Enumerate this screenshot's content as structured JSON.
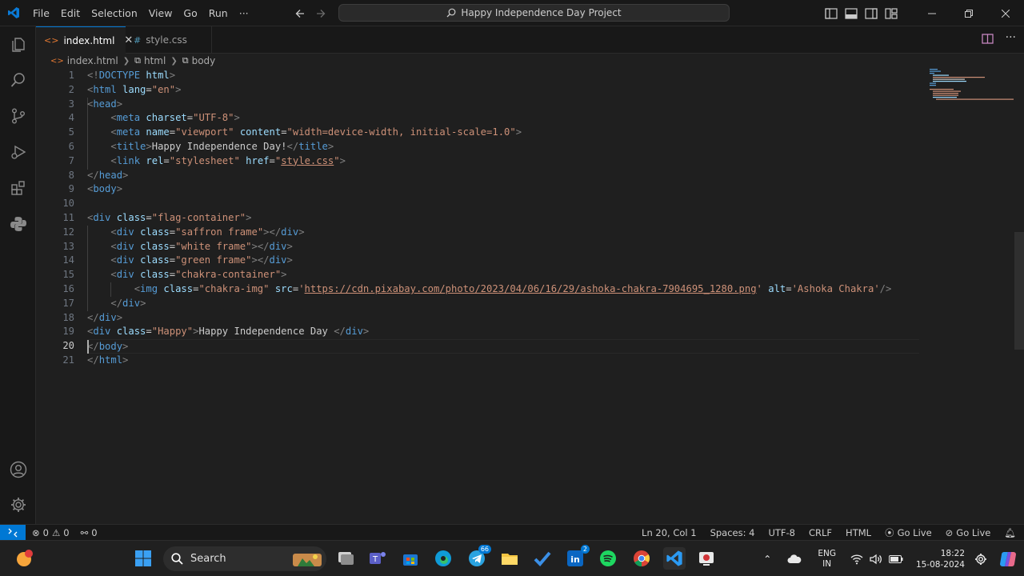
{
  "window": {
    "menu": [
      "File",
      "Edit",
      "Selection",
      "View",
      "Go",
      "Run",
      "···"
    ],
    "search_label": "Happy Independence Day Project"
  },
  "tabs": [
    {
      "label": "index.html",
      "icon": "html-file-icon",
      "active": true
    },
    {
      "label": "style.css",
      "icon": "css-file-icon",
      "active": false
    }
  ],
  "breadcrumb": [
    "index.html",
    "html",
    "body"
  ],
  "editor": {
    "line_numbers": [
      "1",
      "2",
      "3",
      "4",
      "5",
      "6",
      "7",
      "8",
      "9",
      "10",
      "11",
      "12",
      "13",
      "14",
      "15",
      "16",
      "17",
      "18",
      "19",
      "20",
      "21"
    ],
    "current_line": "20",
    "lines": [
      [
        [
          "p",
          "<!"
        ],
        [
          "t",
          "DOCTYPE"
        ],
        [
          "x",
          " "
        ],
        [
          "a",
          "html"
        ],
        [
          "p",
          ">"
        ]
      ],
      [
        [
          "p",
          "<"
        ],
        [
          "t",
          "html"
        ],
        [
          "x",
          " "
        ],
        [
          "a",
          "lang"
        ],
        [
          "x",
          "="
        ],
        [
          "s",
          "\"en\""
        ],
        [
          "p",
          ">"
        ]
      ],
      [
        [
          "p",
          "<"
        ],
        [
          "t",
          "head"
        ],
        [
          "p",
          ">"
        ]
      ],
      [
        [
          "x",
          "    "
        ],
        [
          "p",
          "<"
        ],
        [
          "t",
          "meta"
        ],
        [
          "x",
          " "
        ],
        [
          "a",
          "charset"
        ],
        [
          "x",
          "="
        ],
        [
          "s",
          "\"UTF-8\""
        ],
        [
          "p",
          ">"
        ]
      ],
      [
        [
          "x",
          "    "
        ],
        [
          "p",
          "<"
        ],
        [
          "t",
          "meta"
        ],
        [
          "x",
          " "
        ],
        [
          "a",
          "name"
        ],
        [
          "x",
          "="
        ],
        [
          "s",
          "\"viewport\""
        ],
        [
          "x",
          " "
        ],
        [
          "a",
          "content"
        ],
        [
          "x",
          "="
        ],
        [
          "s",
          "\"width=device-width, initial-scale=1.0\""
        ],
        [
          "p",
          ">"
        ]
      ],
      [
        [
          "x",
          "    "
        ],
        [
          "p",
          "<"
        ],
        [
          "t",
          "title"
        ],
        [
          "p",
          ">"
        ],
        [
          "x",
          "Happy Independence Day!"
        ],
        [
          "p",
          "</"
        ],
        [
          "t",
          "title"
        ],
        [
          "p",
          ">"
        ]
      ],
      [
        [
          "x",
          "    "
        ],
        [
          "p",
          "<"
        ],
        [
          "t",
          "link"
        ],
        [
          "x",
          " "
        ],
        [
          "a",
          "rel"
        ],
        [
          "x",
          "="
        ],
        [
          "s",
          "\"stylesheet\""
        ],
        [
          "x",
          " "
        ],
        [
          "a",
          "href"
        ],
        [
          "x",
          "="
        ],
        [
          "s",
          "\""
        ],
        [
          "u",
          "style.css"
        ],
        [
          "s",
          "\""
        ],
        [
          "p",
          ">"
        ]
      ],
      [
        [
          "p",
          "</"
        ],
        [
          "t",
          "head"
        ],
        [
          "p",
          ">"
        ]
      ],
      [
        [
          "p",
          "<"
        ],
        [
          "t",
          "body"
        ],
        [
          "p",
          ">"
        ]
      ],
      [],
      [
        [
          "p",
          "<"
        ],
        [
          "t",
          "div"
        ],
        [
          "x",
          " "
        ],
        [
          "a",
          "class"
        ],
        [
          "x",
          "="
        ],
        [
          "s",
          "\"flag-container\""
        ],
        [
          "p",
          ">"
        ]
      ],
      [
        [
          "x",
          "    "
        ],
        [
          "p",
          "<"
        ],
        [
          "t",
          "div"
        ],
        [
          "x",
          " "
        ],
        [
          "a",
          "class"
        ],
        [
          "x",
          "="
        ],
        [
          "s",
          "\"saffron frame\""
        ],
        [
          "p",
          "></"
        ],
        [
          "t",
          "div"
        ],
        [
          "p",
          ">"
        ]
      ],
      [
        [
          "x",
          "    "
        ],
        [
          "p",
          "<"
        ],
        [
          "t",
          "div"
        ],
        [
          "x",
          " "
        ],
        [
          "a",
          "class"
        ],
        [
          "x",
          "="
        ],
        [
          "s",
          "\"white frame\""
        ],
        [
          "p",
          "></"
        ],
        [
          "t",
          "div"
        ],
        [
          "p",
          ">"
        ]
      ],
      [
        [
          "x",
          "    "
        ],
        [
          "p",
          "<"
        ],
        [
          "t",
          "div"
        ],
        [
          "x",
          " "
        ],
        [
          "a",
          "class"
        ],
        [
          "x",
          "="
        ],
        [
          "s",
          "\"green frame\""
        ],
        [
          "p",
          "></"
        ],
        [
          "t",
          "div"
        ],
        [
          "p",
          ">"
        ]
      ],
      [
        [
          "x",
          "    "
        ],
        [
          "p",
          "<"
        ],
        [
          "t",
          "div"
        ],
        [
          "x",
          " "
        ],
        [
          "a",
          "class"
        ],
        [
          "x",
          "="
        ],
        [
          "s",
          "\"chakra-container\""
        ],
        [
          "p",
          ">"
        ]
      ],
      [
        [
          "x",
          "        "
        ],
        [
          "p",
          "<"
        ],
        [
          "t",
          "img"
        ],
        [
          "x",
          " "
        ],
        [
          "a",
          "class"
        ],
        [
          "x",
          "="
        ],
        [
          "s",
          "\"chakra-img\""
        ],
        [
          "x",
          " "
        ],
        [
          "a",
          "src"
        ],
        [
          "x",
          "="
        ],
        [
          "s",
          "'"
        ],
        [
          "u",
          "https://cdn.pixabay.com/photo/2023/04/06/16/29/ashoka-chakra-7904695_1280.png"
        ],
        [
          "s",
          "'"
        ],
        [
          "x",
          " "
        ],
        [
          "a",
          "alt"
        ],
        [
          "x",
          "="
        ],
        [
          "s",
          "'Ashoka Chakra'"
        ],
        [
          "p",
          "/>"
        ]
      ],
      [
        [
          "x",
          "    "
        ],
        [
          "p",
          "</"
        ],
        [
          "t",
          "div"
        ],
        [
          "p",
          ">"
        ]
      ],
      [
        [
          "p",
          "</"
        ],
        [
          "t",
          "div"
        ],
        [
          "p",
          ">"
        ]
      ],
      [
        [
          "p",
          "<"
        ],
        [
          "t",
          "div"
        ],
        [
          "x",
          " "
        ],
        [
          "a",
          "class"
        ],
        [
          "x",
          "="
        ],
        [
          "s",
          "\"Happy\""
        ],
        [
          "p",
          ">"
        ],
        [
          "x",
          "Happy Independence Day "
        ],
        [
          "p",
          "</"
        ],
        [
          "t",
          "div"
        ],
        [
          "p",
          ">"
        ]
      ],
      [
        [
          "p",
          "</"
        ],
        [
          "t",
          "body"
        ],
        [
          "p",
          ">"
        ]
      ],
      [
        [
          "p",
          "</"
        ],
        [
          "t",
          "html"
        ],
        [
          "p",
          ">"
        ]
      ]
    ]
  },
  "statusbar": {
    "errors": "0",
    "warnings": "0",
    "ports": "0",
    "position": "Ln 20, Col 1",
    "spaces": "Spaces: 4",
    "encoding": "UTF-8",
    "eol": "CRLF",
    "language": "HTML",
    "golive1": "Go Live",
    "golive2": "Go Live"
  },
  "taskbar": {
    "search_label": "Search",
    "lang_top": "ENG",
    "lang_bottom": "IN",
    "time": "18:22",
    "date": "15-08-2024",
    "telegram_badge": "66",
    "linkedin_badge": "2"
  },
  "colors": {
    "accent": "#0078d4",
    "tag": "#569cd6",
    "attribute": "#9cdcfe",
    "string": "#ce9178"
  }
}
